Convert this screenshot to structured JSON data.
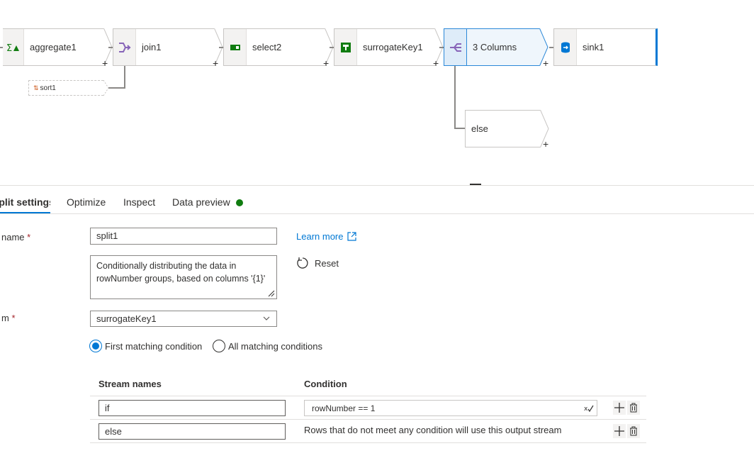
{
  "pipeline": {
    "nodes": [
      {
        "label": "aggregate1",
        "icon": "aggregate-icon"
      },
      {
        "label": "join1",
        "icon": "join-icon"
      },
      {
        "label": "select2",
        "icon": "select-icon"
      },
      {
        "label": "surrogateKey1",
        "icon": "surrogate-key-icon"
      },
      {
        "label": "3 Columns",
        "icon": "split-icon"
      },
      {
        "label": "sink1",
        "icon": "sink-icon"
      }
    ],
    "sort_node": {
      "label": "sort1",
      "icon": "sort-icon"
    },
    "else_node": {
      "label": "else"
    },
    "plus": "+"
  },
  "tabs": {
    "split_settings": "Split settings",
    "optimize": "Optimize",
    "inspect": "Inspect",
    "data_preview": "Data preview"
  },
  "form": {
    "name_label": "name",
    "required_mark": "*",
    "name_value": "split1",
    "description_value": "Conditionally distributing the data in rowNumber groups, based on columns '{1}'",
    "stream_label": "m",
    "stream_value": "surrogateKey1",
    "learn_more": "Learn more",
    "reset": "Reset",
    "radio_first": "First matching condition",
    "radio_all": "All matching conditions"
  },
  "table": {
    "headers": {
      "stream_names": "Stream names",
      "condition": "Condition"
    },
    "rows": [
      {
        "stream": "if",
        "condition": "rowNumber == 1"
      },
      {
        "stream": "else",
        "condition": "Rows that do not meet any condition will use this output stream"
      }
    ]
  },
  "colors": {
    "accent": "#0078d4",
    "status": "#107c10",
    "selected_bg": "#eff6fc"
  }
}
